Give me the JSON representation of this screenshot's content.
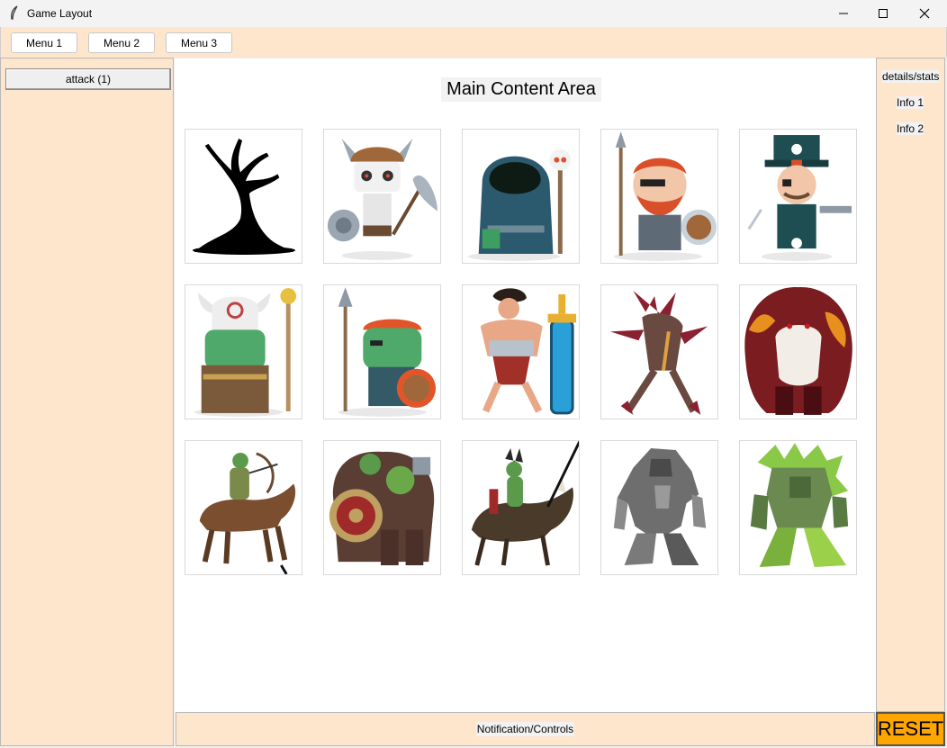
{
  "window": {
    "title": "Game Layout"
  },
  "menubar": {
    "items": [
      "Menu 1",
      "Menu 2",
      "Menu 3"
    ]
  },
  "left_panel": {
    "attack_label": "attack (1)"
  },
  "main": {
    "title": "Main Content Area"
  },
  "cards": [
    "dead-tree",
    "viking-skeleton",
    "hooded-cultist",
    "red-bearded-dwarf",
    "pirate-captain",
    "orc-shaman",
    "orc-spearman",
    "barbarian-swordsman",
    "red-eyed-demon",
    "red-ogre",
    "orc-horse-archer",
    "armored-orc-shield",
    "goblin-boar-rider",
    "stone-golem",
    "moss-golem"
  ],
  "right_panel": {
    "header": "details/stats",
    "info1": "Info 1",
    "info2": "Info 2"
  },
  "bottom": {
    "label": "Notification/Controls"
  },
  "reset_label": "RESET",
  "colors": {
    "panel": "#fde6cc",
    "reset": "#ffa500"
  }
}
